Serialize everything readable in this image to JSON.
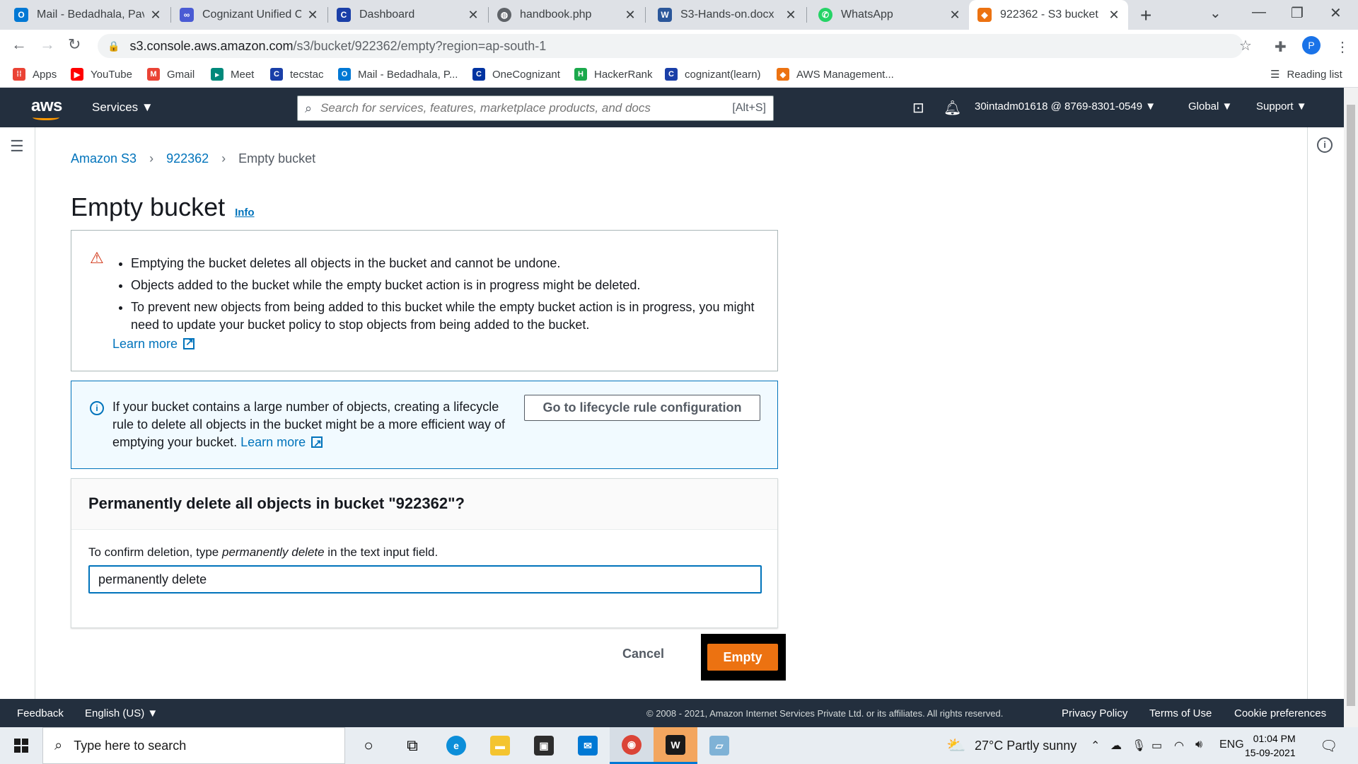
{
  "browser": {
    "tabs": [
      {
        "title": "Mail - Bedadhala, Pava",
        "icon": "outlook-icon",
        "color": "#0078d4"
      },
      {
        "title": "Cognizant Unified Co",
        "icon": "cognizant-unified-icon",
        "color": "#4a5bd4"
      },
      {
        "title": "Dashboard",
        "icon": "cognizant-icon",
        "color": "#1a3fa8"
      },
      {
        "title": "handbook.php",
        "icon": "globe-icon",
        "color": "#5f6368"
      },
      {
        "title": "S3-Hands-on.docx",
        "icon": "word-icon",
        "color": "#2b579a"
      },
      {
        "title": "WhatsApp",
        "icon": "whatsapp-icon",
        "color": "#25d366"
      },
      {
        "title": "922362 - S3 bucket",
        "icon": "aws-s3-icon",
        "color": "#ec7211"
      }
    ],
    "url_host": "s3.console.aws.amazon.com",
    "url_path": "/s3/bucket/922362/empty?region=ap-south-1",
    "profile_initial": "P",
    "bookmarks": [
      {
        "label": "Apps",
        "icon": "apps-grid-icon",
        "color": "#ea4335"
      },
      {
        "label": "YouTube",
        "icon": "youtube-icon",
        "color": "#ff0000"
      },
      {
        "label": "Gmail",
        "icon": "gmail-icon",
        "color": "#ea4335"
      },
      {
        "label": "Meet",
        "icon": "meet-icon",
        "color": "#00897b"
      },
      {
        "label": "tecstac",
        "icon": "cognizant-icon",
        "color": "#1a3fa8"
      },
      {
        "label": "Mail - Bedadhala, P...",
        "icon": "outlook-icon",
        "color": "#0078d4"
      },
      {
        "label": "OneCognizant",
        "icon": "onecognizant-icon",
        "color": "#0033a1"
      },
      {
        "label": "HackerRank",
        "icon": "hackerrank-icon",
        "color": "#1ba94c"
      },
      {
        "label": "cognizant(learn)",
        "icon": "cognizant-icon",
        "color": "#1a3fa8"
      },
      {
        "label": "AWS Management...",
        "icon": "aws-icon",
        "color": "#ec7211"
      }
    ],
    "reading_list": "Reading list"
  },
  "aws_header": {
    "logo": "aws",
    "services": "Services",
    "search_placeholder": "Search for services, features, marketplace products, and docs",
    "search_shortcut": "[Alt+S]",
    "account": "30intadm01618 @ 8769-8301-0549",
    "region": "Global",
    "support": "Support"
  },
  "breadcrumb": {
    "root": "Amazon S3",
    "bucket": "922362",
    "current": "Empty bucket"
  },
  "page": {
    "title": "Empty bucket",
    "info": "Info"
  },
  "warning": {
    "bullets": [
      "Emptying the bucket deletes all objects in the bucket and cannot be undone.",
      "Objects added to the bucket while the empty bucket action is in progress might be deleted.",
      "To prevent new objects from being added to this bucket while the empty bucket action is in progress, you might need to update your bucket policy to stop objects from being added to the bucket."
    ],
    "learn_more": "Learn more"
  },
  "info_alert": {
    "text": "If your bucket contains a large number of objects, creating a lifecycle rule to delete all objects in the bucket might be a more efficient way of emptying your bucket.",
    "learn_more": "Learn more",
    "button": "Go to lifecycle rule configuration"
  },
  "confirm": {
    "heading": "Permanently delete all objects in bucket \"922362\"?",
    "label_prefix": "To confirm deletion, type ",
    "label_phrase": "permanently delete",
    "label_suffix": " in the text input field.",
    "input_value": "permanently delete"
  },
  "actions": {
    "cancel": "Cancel",
    "empty": "Empty"
  },
  "colors": {
    "aws_nav": "#232f3e",
    "primary_button": "#ec7211",
    "link": "#0073bb",
    "warning": "#d13212"
  },
  "footer": {
    "feedback": "Feedback",
    "language": "English (US)",
    "copyright": "© 2008 - 2021, Amazon Internet Services Private Ltd. or its affiliates. All rights reserved.",
    "privacy": "Privacy Policy",
    "terms": "Terms of Use",
    "cookies": "Cookie preferences"
  },
  "taskbar": {
    "search_placeholder": "Type here to search",
    "weather": "27°C  Partly sunny",
    "lang": "ENG",
    "time": "01:04 PM",
    "date": "15-09-2021"
  }
}
